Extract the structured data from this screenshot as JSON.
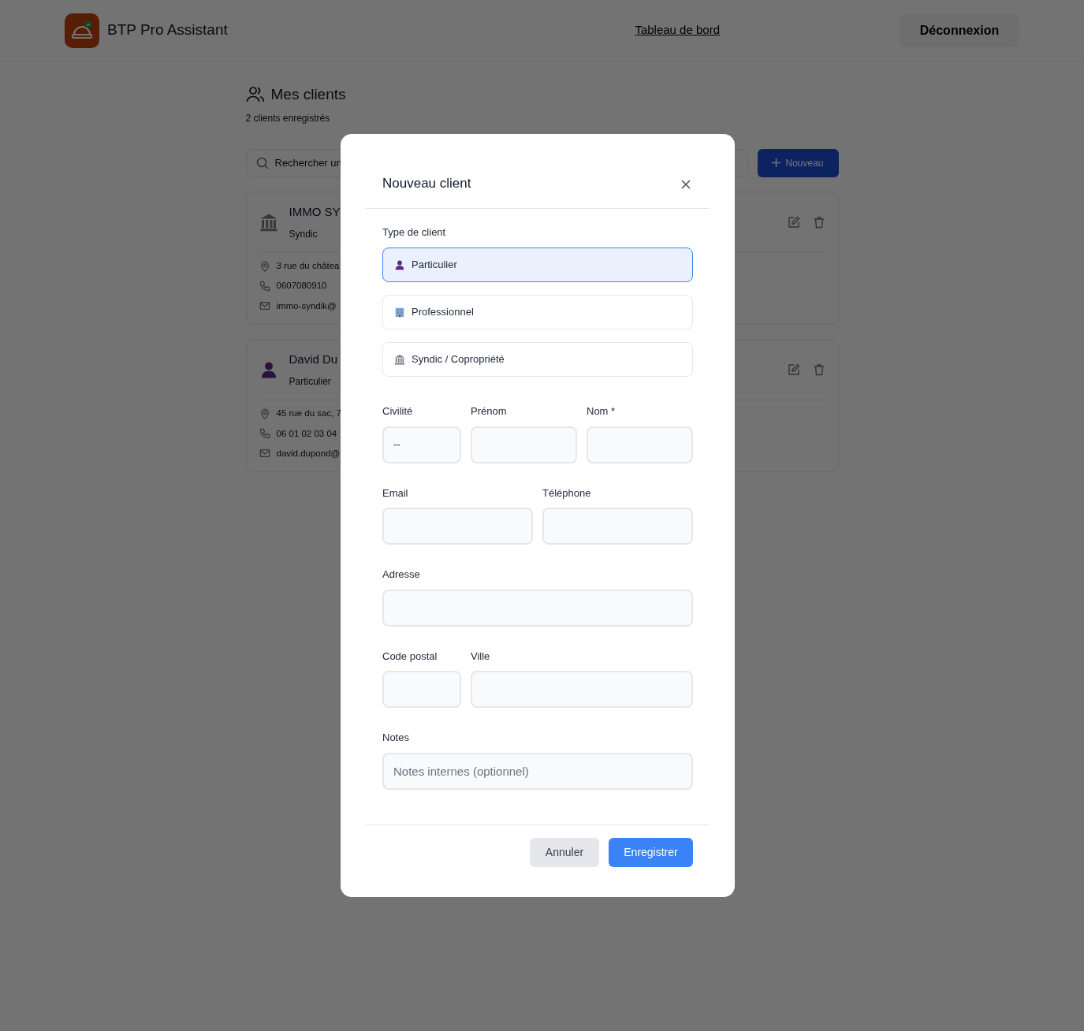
{
  "navbar": {
    "brand": "BTP Pro Assistant",
    "link": "Tableau de bord",
    "logout": "Déconnexion"
  },
  "page": {
    "title": "Mes clients",
    "subtitle": "2 clients enregistrés",
    "search_placeholder": "Rechercher un",
    "new_button": "Nouveau",
    "clients": [
      {
        "kind": "syndic",
        "name": "IMMO SY",
        "type": "Syndic",
        "address": "3 rue du châtea",
        "phone": "0607080910",
        "email": "immo-syndik@"
      },
      {
        "kind": "particulier",
        "name": "David Du",
        "type": "Particulier",
        "address": "45 rue du sac, 7",
        "phone": "06 01 02 03 04",
        "email": "david.dupond@"
      }
    ]
  },
  "modal": {
    "title": "Nouveau client",
    "type_label": "Type de client",
    "client_types": [
      {
        "kind": "particulier",
        "label": "Particulier",
        "selected": true
      },
      {
        "kind": "professionnel",
        "label": "Professionnel",
        "selected": false
      },
      {
        "kind": "syndic",
        "label": "Syndic / Copropriété",
        "selected": false
      }
    ],
    "rows": [
      [
        {
          "kind": "select",
          "label": "Civilité",
          "value": "--"
        },
        {
          "kind": "text",
          "label": "Prénom"
        },
        {
          "kind": "text",
          "label": "Nom *"
        }
      ],
      [
        {
          "kind": "email",
          "label": "Email"
        },
        {
          "kind": "tel",
          "label": "Téléphone"
        }
      ],
      [
        {
          "kind": "text",
          "label": "Adresse"
        }
      ],
      [
        {
          "kind": "postal",
          "label": "Code postal"
        },
        {
          "kind": "text",
          "label": "Ville"
        }
      ],
      [
        {
          "kind": "text",
          "label": "Notes",
          "placeholder": "Notes internes (optionnel)"
        }
      ]
    ],
    "cancel": "Annuler",
    "save": "Enregistrer"
  }
}
